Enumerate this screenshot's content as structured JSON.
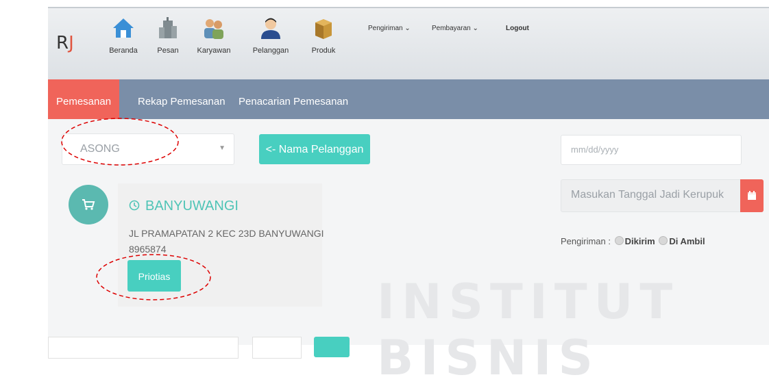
{
  "brand": {
    "r": "R",
    "j": "J"
  },
  "topnav": {
    "items": [
      {
        "label": "Beranda",
        "icon": "home-icon"
      },
      {
        "label": "Pesan",
        "icon": "building-icon"
      },
      {
        "label": "Karyawan",
        "icon": "users-icon"
      },
      {
        "label": "Pelanggan",
        "icon": "customer-icon"
      },
      {
        "label": "Produk",
        "icon": "box-icon"
      }
    ],
    "pengiriman": "Pengiriman",
    "pembayaran": "Pembayaran",
    "logout": "Logout",
    "caret": "⌄"
  },
  "subnav": {
    "tabs": [
      "Pemesanan",
      "Rekap Pemesanan",
      "Penacarian Pemesanan"
    ]
  },
  "form": {
    "customer_select": "ASONG",
    "customer_button": "<- Nama Pelanggan",
    "date_placeholder": "mm/dd/yyyy",
    "ready_date_placeholder": "Masukan Tanggal Jadi Kerupuk",
    "shipping_label": "Pengiriman :",
    "shipping_opt1": "Dikirim",
    "shipping_opt2": "Di Ambil"
  },
  "customer_card": {
    "city": "BANYUWANGI",
    "address": "JL PRAMAPATAN 2 KEC 23D BANYUWANGI",
    "phone": "8965874",
    "priority_button": "Priotias"
  },
  "watermark": "INSTITUT BISNIS",
  "colors": {
    "accent_red": "#f0645a",
    "teal": "#48cfc0",
    "subnav": "#7a8ea8"
  }
}
